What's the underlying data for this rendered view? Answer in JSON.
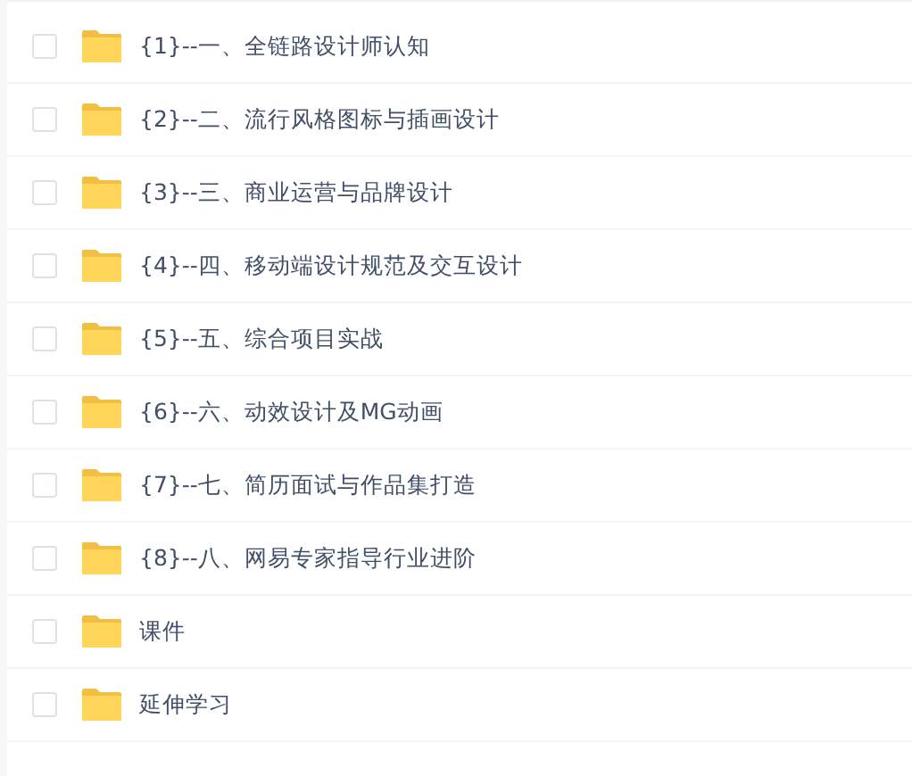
{
  "files": [
    {
      "name": "{1}--一、全链路设计师认知",
      "checked": false
    },
    {
      "name": "{2}--二、流行风格图标与插画设计",
      "checked": false
    },
    {
      "name": "{3}--三、商业运营与品牌设计",
      "checked": false
    },
    {
      "name": "{4}--四、移动端设计规范及交互设计",
      "checked": false
    },
    {
      "name": "{5}--五、综合项目实战",
      "checked": false
    },
    {
      "name": "{6}--六、动效设计及MG动画",
      "checked": false
    },
    {
      "name": "{7}--七、简历面试与作品集打造",
      "checked": false
    },
    {
      "name": "{8}--八、网易专家指导行业进阶",
      "checked": false
    },
    {
      "name": "课件",
      "checked": false
    },
    {
      "name": "延伸学习",
      "checked": false
    }
  ]
}
